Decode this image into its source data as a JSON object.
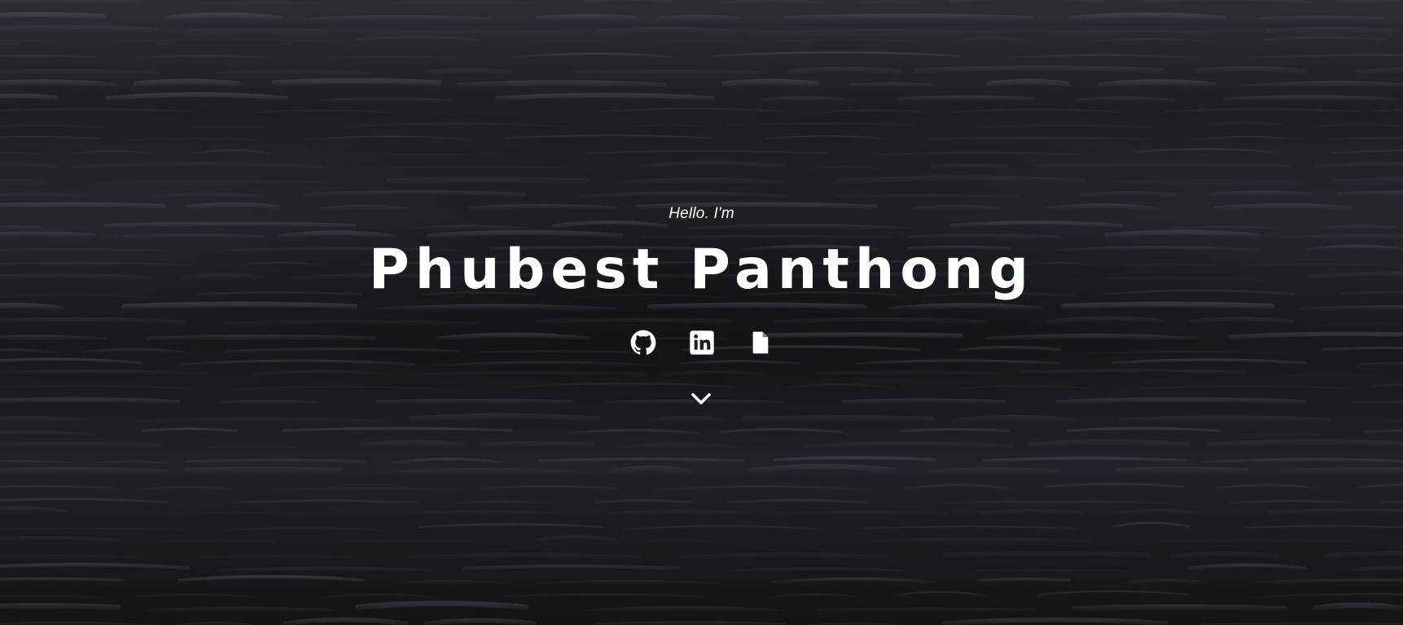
{
  "hero": {
    "greeting": "Hello. I'm",
    "name": "Phubest Panthong",
    "background": "dark-water-waves"
  },
  "socials": [
    {
      "icon": "github-icon",
      "label": "GitHub"
    },
    {
      "icon": "linkedin-icon",
      "label": "LinkedIn"
    },
    {
      "icon": "document-icon",
      "label": "Resume"
    }
  ],
  "scroll": {
    "icon": "chevron-down-icon"
  },
  "colors": {
    "text": "#ffffff",
    "background": "#16181b"
  }
}
